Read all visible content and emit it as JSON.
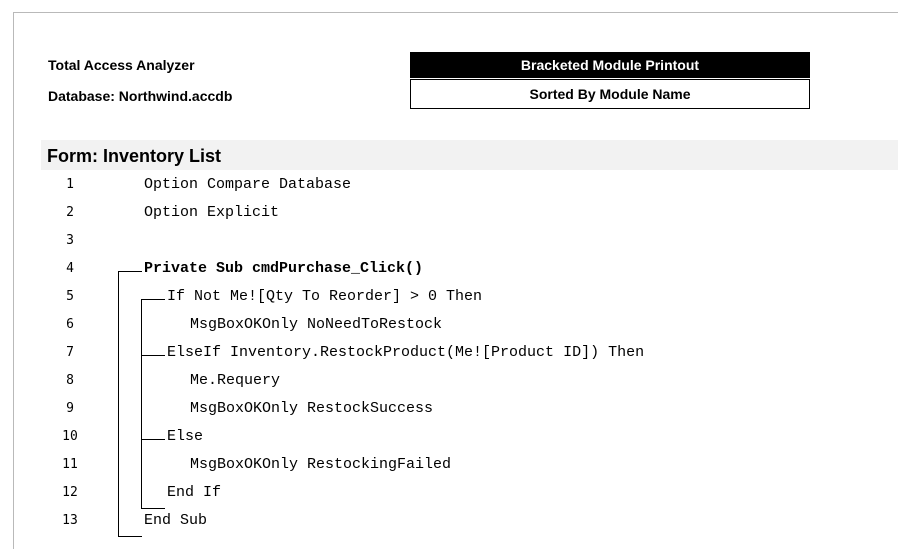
{
  "header": {
    "app_name": "Total Access Analyzer",
    "database": "Database: Northwind.accdb",
    "report_title": "Bracketed Module Printout",
    "sort_label": "Sorted By Module Name"
  },
  "module": {
    "title": "Form: Inventory List"
  },
  "code_lines": [
    {
      "num": "1",
      "text": "Option Compare Database"
    },
    {
      "num": "2",
      "text": "Option Explicit"
    },
    {
      "num": "3",
      "text": ""
    },
    {
      "num": "4",
      "text": "Private Sub cmdPurchase_Click()"
    },
    {
      "num": "5",
      "text": "If Not Me![Qty To Reorder] > 0 Then"
    },
    {
      "num": "6",
      "text": "MsgBoxOKOnly NoNeedToRestock"
    },
    {
      "num": "7",
      "text": "ElseIf Inventory.RestockProduct(Me![Product ID]) Then"
    },
    {
      "num": "8",
      "text": "Me.Requery"
    },
    {
      "num": "9",
      "text": "MsgBoxOKOnly RestockSuccess"
    },
    {
      "num": "10",
      "text": "Else"
    },
    {
      "num": "11",
      "text": "MsgBoxOKOnly RestockingFailed"
    },
    {
      "num": "12",
      "text": "End If"
    },
    {
      "num": "13",
      "text": "End Sub"
    }
  ]
}
